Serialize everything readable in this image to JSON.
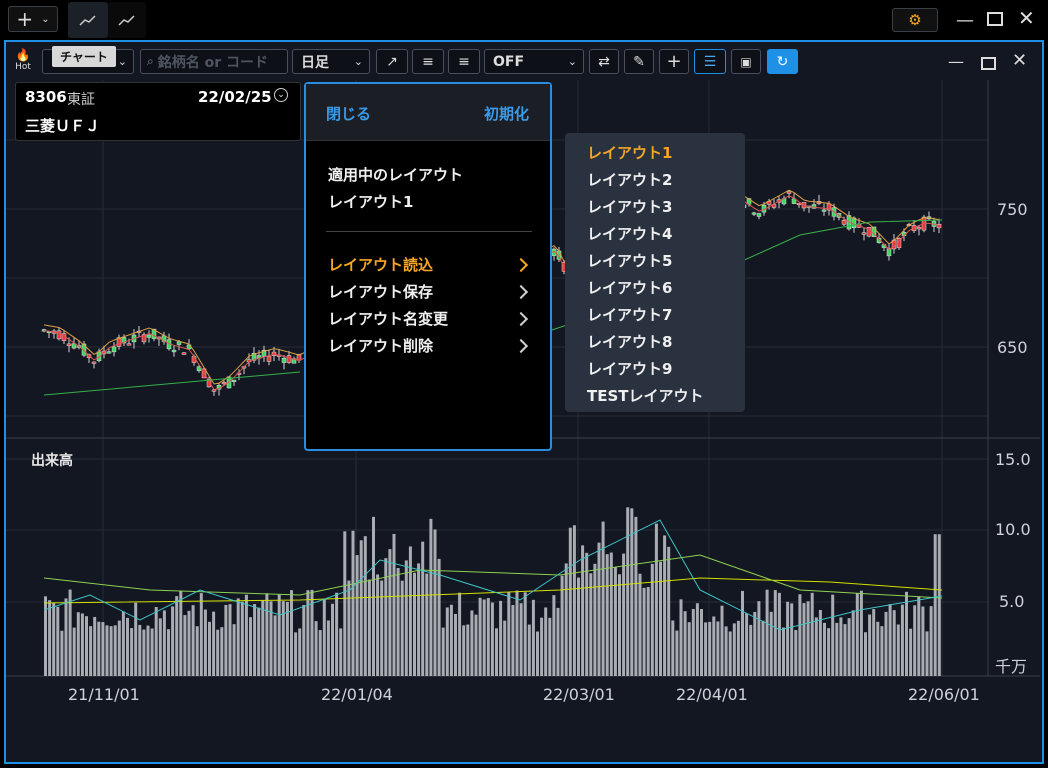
{
  "app": {
    "tooltip": "チャート",
    "hot_label": "Hot",
    "search_placeholder": "銘柄名 or コード",
    "period": "日足",
    "indicator_value": "OFF"
  },
  "info": {
    "code": "8306",
    "market": "東証",
    "date": "22/02/25",
    "name": "三菱ＵＦＪ"
  },
  "menu": {
    "close_label": "閉じる",
    "reset_label": "初期化",
    "current_header": "適用中のレイアウト",
    "current_value": "レイアウト1",
    "items": [
      "レイアウト読込",
      "レイアウト保存",
      "レイアウト名変更",
      "レイアウト削除"
    ]
  },
  "submenu": {
    "items": [
      "レイアウト1",
      "レイアウト2",
      "レイアウト3",
      "レイアウト4",
      "レイアウト5",
      "レイアウト6",
      "レイアウト7",
      "レイアウト8",
      "レイアウト9",
      "TESTレイアウト"
    ]
  },
  "chart_data": {
    "type": "candlestick",
    "price_axis_ticks": [
      "750",
      "650"
    ],
    "volume_label": "出来高",
    "volume_axis_ticks": [
      "15.0",
      "10.0",
      "5.0"
    ],
    "volume_unit": "千万",
    "x_ticks": [
      "21/11/01",
      "22/01/04",
      "22/03/01",
      "22/04/01",
      "22/06/01"
    ],
    "ylim": [
      595,
      800
    ]
  },
  "colors": {
    "accent": "#1e90e6",
    "up": "#3ed65f",
    "down": "#e23b3b",
    "highlight": "#f5a623"
  }
}
